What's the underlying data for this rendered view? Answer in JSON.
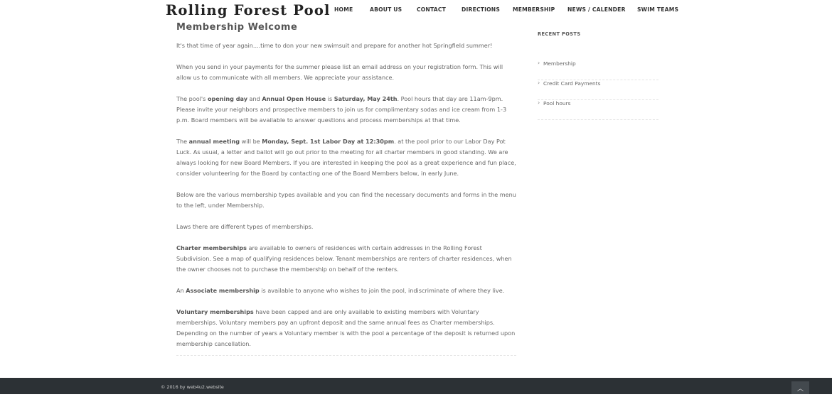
{
  "site": {
    "title": "Rolling Forest Pool"
  },
  "nav": {
    "home": "HOME",
    "about": "ABOUT US",
    "contact": "CONTACT",
    "directions": "DIRECTIONS",
    "membership": "MEMBERSHIP",
    "news": "NEWS / CALENDER",
    "swim": "SWIM TEAMS"
  },
  "page": {
    "heading": "Membership Welcome"
  },
  "content": {
    "p1": "It's that time of year again....time to don your new swimsuit and prepare for another hot Springfield summer!",
    "p2": "When you send in your payments for the summer please list an email address on your registration form. This will allow us to communicate with all members. We appreciate your assistance.",
    "p3": {
      "t1": "The pool's ",
      "b1": "opening day",
      "t2": " and ",
      "b2": "Annual Open House",
      "t3": " is ",
      "b3": "Saturday, May 24th",
      "t4": ". Pool hours that day are 11am-9pm. Please invite your neighbors and prospective members to join us for complimentary sodas and ice cream from 1-3 p.m. Board members will be available to answer questions and process memberships at that time."
    },
    "p4": {
      "t1": "The ",
      "b1": "annual meeting",
      "t2": " will be ",
      "b2": "Monday, Sept. 1st Labor Day at 12:30pm",
      "t3": ". at the pool prior to our Labor Day Pot Luck. As usual, a letter and ballot will go out prior to the meeting for all charter members in good standing. We are always looking for new Board Members. If you are interested in keeping the pool as a great experience and fun place, consider volunteering for the Board by contacting one of the Board Members below, in early June."
    },
    "p5": "Below are the various membership types available and you can find the necessary documents and forms in the menu to the left, under Membership.",
    "p6": "Laws there are different types of memberships.",
    "p7": {
      "b1": "Charter memberships",
      "t1": " are available to owners of residences with certain addresses in the Rolling Forest Subdivision. See a map of qualifying residences below. Tenant memberships are renters of charter residences, when the owner chooses not to purchase the membership on behalf of the renters."
    },
    "p8": {
      "t1": "An ",
      "b1": "Associate membership",
      "t2": " is available to anyone who wishes to join the pool, indiscriminate of where they live."
    },
    "p9": {
      "b1": "Voluntary memberships",
      "t1": " have been capped and are only available to existing members with Voluntary memberships. Voluntary members pay an upfront deposit and the same annual fees as Charter memberships. Depending on the number of years a Voluntary member is with the pool a percentage of the deposit is returned upon membership cancellation."
    }
  },
  "sidebar": {
    "title": "RECENT POSTS",
    "items": [
      {
        "label": "Membership"
      },
      {
        "label": "Credit Card Payments"
      },
      {
        "label": "Pool hours"
      }
    ]
  },
  "footer": {
    "copyright": "© 2016 by web4u2.website"
  }
}
